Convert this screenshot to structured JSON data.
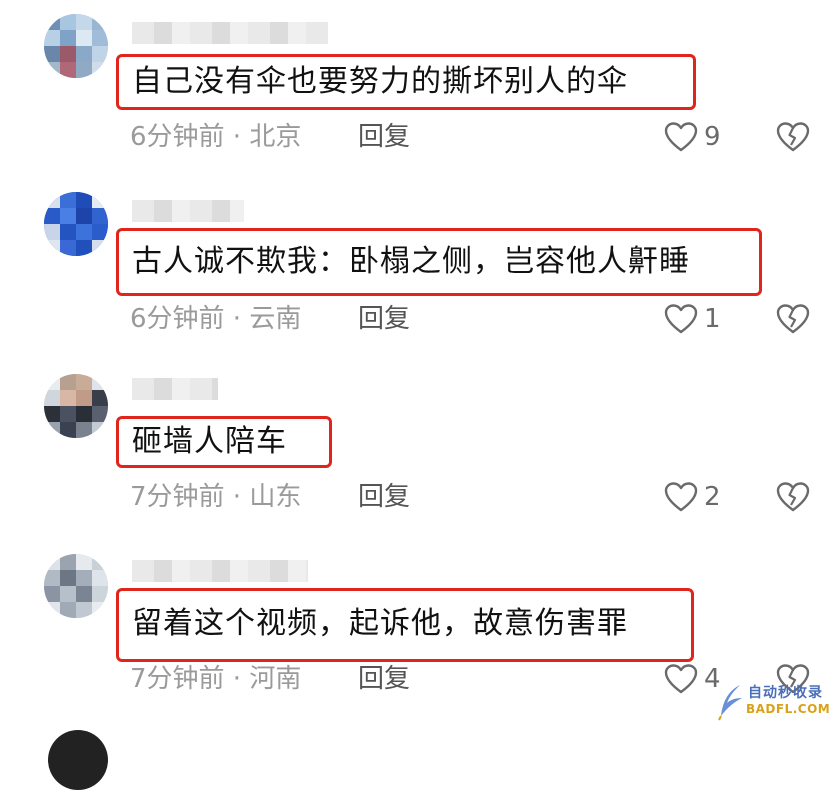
{
  "comments": [
    {
      "text": "自己没有伞也要努力的撕坏别人的伞",
      "meta": "6分钟前 · 北京",
      "reply_label": "回复",
      "likes": "9"
    },
    {
      "text": "古人诚不欺我：卧榻之侧，岂容他人鼾睡",
      "meta": "6分钟前 · 云南",
      "reply_label": "回复",
      "likes": "1"
    },
    {
      "text": "砸墙人陪车",
      "meta": "7分钟前 · 山东",
      "reply_label": "回复",
      "likes": "2"
    },
    {
      "text": "留着这个视频，起诉他，故意伤害罪",
      "meta": "7分钟前 · 河南",
      "reply_label": "回复",
      "likes": "4"
    }
  ],
  "icons": {
    "like": "heart-outline-icon",
    "dislike": "broken-heart-icon"
  },
  "colors": {
    "highlight_border": "#e0251c",
    "meta_text": "#9a9a9a"
  },
  "watermark": {
    "line1": "自动秒收录",
    "line2": "BADFL.COM"
  }
}
